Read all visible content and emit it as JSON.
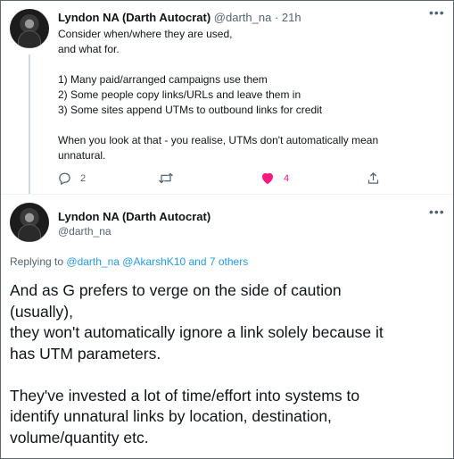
{
  "tweet1": {
    "author_name": "Lyndon NA (Darth Autocrat)",
    "author_handle": "@darth_na",
    "separator": "·",
    "time": "21h",
    "more_icon": "more-horizontal-icon",
    "lines": [
      "Consider when/where they are used,",
      "and what for.",
      "",
      "1) Many paid/arranged campaigns use them",
      "2) Some people copy links/URLs and leave them in",
      "3) Some sites append UTMs to outbound links for credit",
      "",
      "When you look at that - you realise, UTMs don't automatically mean",
      "unnatural."
    ],
    "actions": {
      "reply_count": "2",
      "retweet_count": "",
      "like_count": "4",
      "like_color": "#f91880"
    }
  },
  "tweet2": {
    "author_name": "Lyndon NA (Darth Autocrat)",
    "author_handle": "@darth_na",
    "replying_prefix": "Replying to",
    "replying_to": "@darth_na @AkarshK10 and 7 others",
    "lines": [
      "And as G prefers to verge on the side of caution",
      "(usually),",
      "they won't automatically ignore a link solely because it",
      "has UTM parameters.",
      "",
      "They've invested a lot of time/effort into systems to",
      "identify unnatural links by location, destination,",
      "volume/quantity etc."
    ]
  },
  "colors": {
    "text": "#0f1419",
    "muted": "#536471",
    "link": "#1d9bf0",
    "like": "#f91880"
  }
}
